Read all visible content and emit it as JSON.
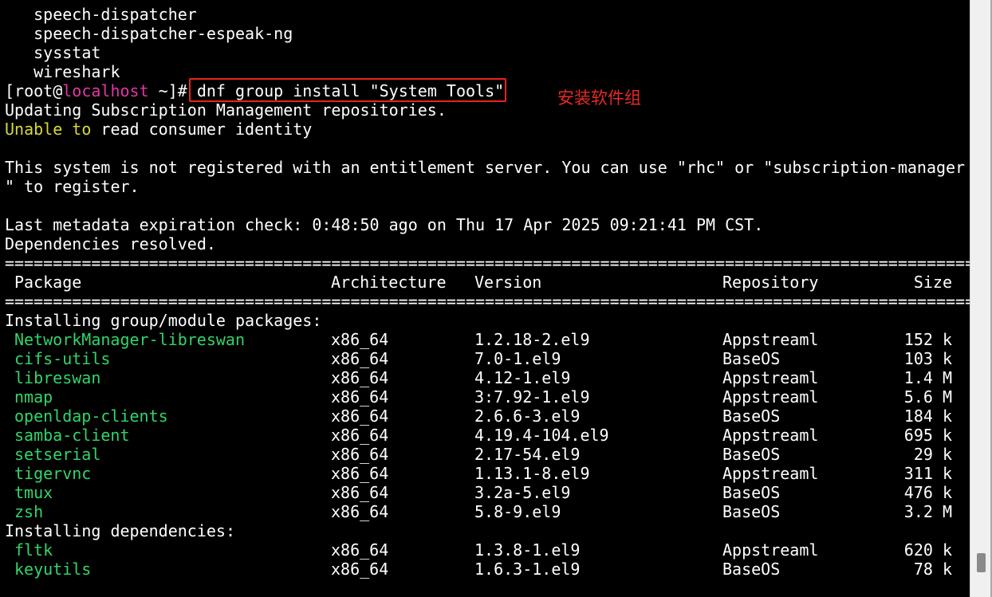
{
  "terminal": {
    "prev_output": [
      "   speech-dispatcher",
      "   speech-dispatcher-espeak-ng",
      "   sysstat",
      "   wireshark"
    ],
    "prompt": {
      "open": "[root@",
      "host": "localhost",
      "close": " ~]#",
      "command": " dnf group install \"System Tools\""
    },
    "output": {
      "updating": "Updating Subscription Management repositories.",
      "unable_word1": "Unable",
      "unable_word2": "to",
      "unable_rest": " read consumer identity",
      "not_registered_1": "This system is not registered with an entitlement server. You can use \"rhc\" or \"subscription-manager",
      "not_registered_2": "\" to register.",
      "metadata": "Last metadata expiration check: 0:48:50 ago on Thu 17 Apr 2025 09:21:41 PM CST.",
      "deps_resolved": "Dependencies resolved.",
      "separator": "==============================================================================================================="
    },
    "table": {
      "headers": {
        "package": "Package",
        "arch": "Architecture",
        "version": "Version",
        "repo": "Repository",
        "size": "Size"
      },
      "section_group": "Installing group/module packages:",
      "group_rows": [
        {
          "package": "NetworkManager-libreswan",
          "arch": "x86_64",
          "version": "1.2.18-2.el9",
          "repo": "Appstreaml",
          "size": "152 k"
        },
        {
          "package": "cifs-utils",
          "arch": "x86_64",
          "version": "7.0-1.el9",
          "repo": "BaseOS",
          "size": "103 k"
        },
        {
          "package": "libreswan",
          "arch": "x86_64",
          "version": "4.12-1.el9",
          "repo": "Appstreaml",
          "size": "1.4 M"
        },
        {
          "package": "nmap",
          "arch": "x86_64",
          "version": "3:7.92-1.el9",
          "repo": "Appstreaml",
          "size": "5.6 M"
        },
        {
          "package": "openldap-clients",
          "arch": "x86_64",
          "version": "2.6.6-3.el9",
          "repo": "BaseOS",
          "size": "184 k"
        },
        {
          "package": "samba-client",
          "arch": "x86_64",
          "version": "4.19.4-104.el9",
          "repo": "Appstreaml",
          "size": "695 k"
        },
        {
          "package": "setserial",
          "arch": "x86_64",
          "version": "2.17-54.el9",
          "repo": "BaseOS",
          "size": "29 k"
        },
        {
          "package": "tigervnc",
          "arch": "x86_64",
          "version": "1.13.1-8.el9",
          "repo": "Appstreaml",
          "size": "311 k"
        },
        {
          "package": "tmux",
          "arch": "x86_64",
          "version": "3.2a-5.el9",
          "repo": "BaseOS",
          "size": "476 k"
        },
        {
          "package": "zsh",
          "arch": "x86_64",
          "version": "5.8-9.el9",
          "repo": "BaseOS",
          "size": "3.2 M"
        }
      ],
      "section_deps": "Installing dependencies:",
      "dep_rows": [
        {
          "package": "fltk",
          "arch": "x86_64",
          "version": "1.3.8-1.el9",
          "repo": "Appstreaml",
          "size": "620 k"
        },
        {
          "package": "keyutils",
          "arch": "x86_64",
          "version": "1.6.3-1.el9",
          "repo": "BaseOS",
          "size": "78 k"
        }
      ]
    }
  },
  "annotation": "安装软件组",
  "colors": {
    "background": "#000000",
    "text": "#ffffff",
    "package": "#33d46a",
    "warning": "#d8d839",
    "host": "#e235a6",
    "highlight": "#e8241c"
  }
}
